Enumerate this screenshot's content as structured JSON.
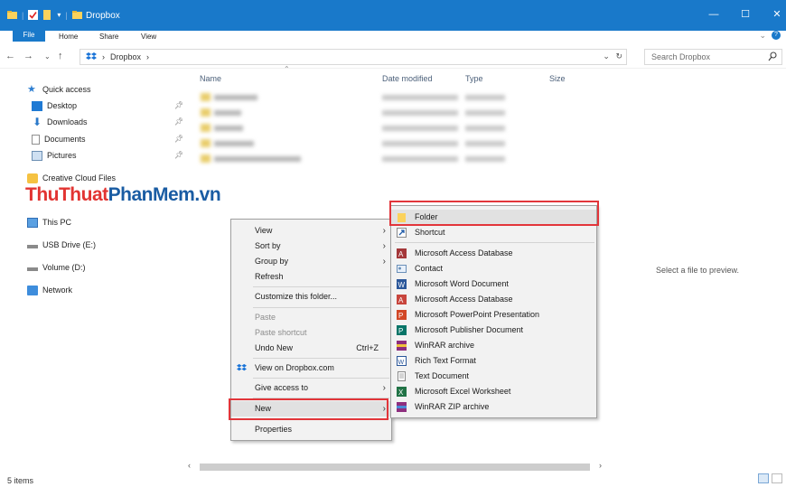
{
  "window": {
    "title": "Dropbox",
    "controls": {
      "minimize": "—",
      "maximize": "☐",
      "close": "✕"
    }
  },
  "ribbon": {
    "tabs": [
      "File",
      "Home",
      "Share",
      "View"
    ]
  },
  "address": {
    "path": [
      "Dropbox"
    ],
    "search_placeholder": "Search Dropbox"
  },
  "nav": {
    "quick_access": "Quick access",
    "pinned": [
      "Desktop",
      "Downloads",
      "Documents",
      "Pictures"
    ],
    "creative_cloud": "Creative Cloud Files",
    "this_pc": "This PC",
    "usb": "USB Drive (E:)",
    "volume": "Volume (D:)",
    "network": "Network"
  },
  "watermark": {
    "part1": "ThuThuat",
    "part2": "PhanMem",
    "part3": ".vn"
  },
  "columns": {
    "name": "Name",
    "date": "Date modified",
    "type": "Type",
    "size": "Size"
  },
  "preview": "Select a file to preview.",
  "status": {
    "items": "5 items"
  },
  "context_menu": {
    "view": "View",
    "sort_by": "Sort by",
    "group_by": "Group by",
    "refresh": "Refresh",
    "customize": "Customize this folder...",
    "paste": "Paste",
    "paste_shortcut": "Paste shortcut",
    "undo_new": "Undo New",
    "undo_shortcut": "Ctrl+Z",
    "view_dropbox": "View on Dropbox.com",
    "give_access": "Give access to",
    "new": "New",
    "properties": "Properties"
  },
  "new_submenu": {
    "items": [
      "Folder",
      "Shortcut",
      "Microsoft Access Database",
      "Contact",
      "Microsoft Word Document",
      "Microsoft Access Database",
      "Microsoft PowerPoint Presentation",
      "Microsoft Publisher Document",
      "WinRAR archive",
      "Rich Text Format",
      "Text Document",
      "Microsoft Excel Worksheet",
      "WinRAR ZIP archive"
    ]
  },
  "colors": {
    "accent": "#1979ca",
    "highlight": "#e2353a",
    "menu_bg": "#f2f2f2"
  }
}
